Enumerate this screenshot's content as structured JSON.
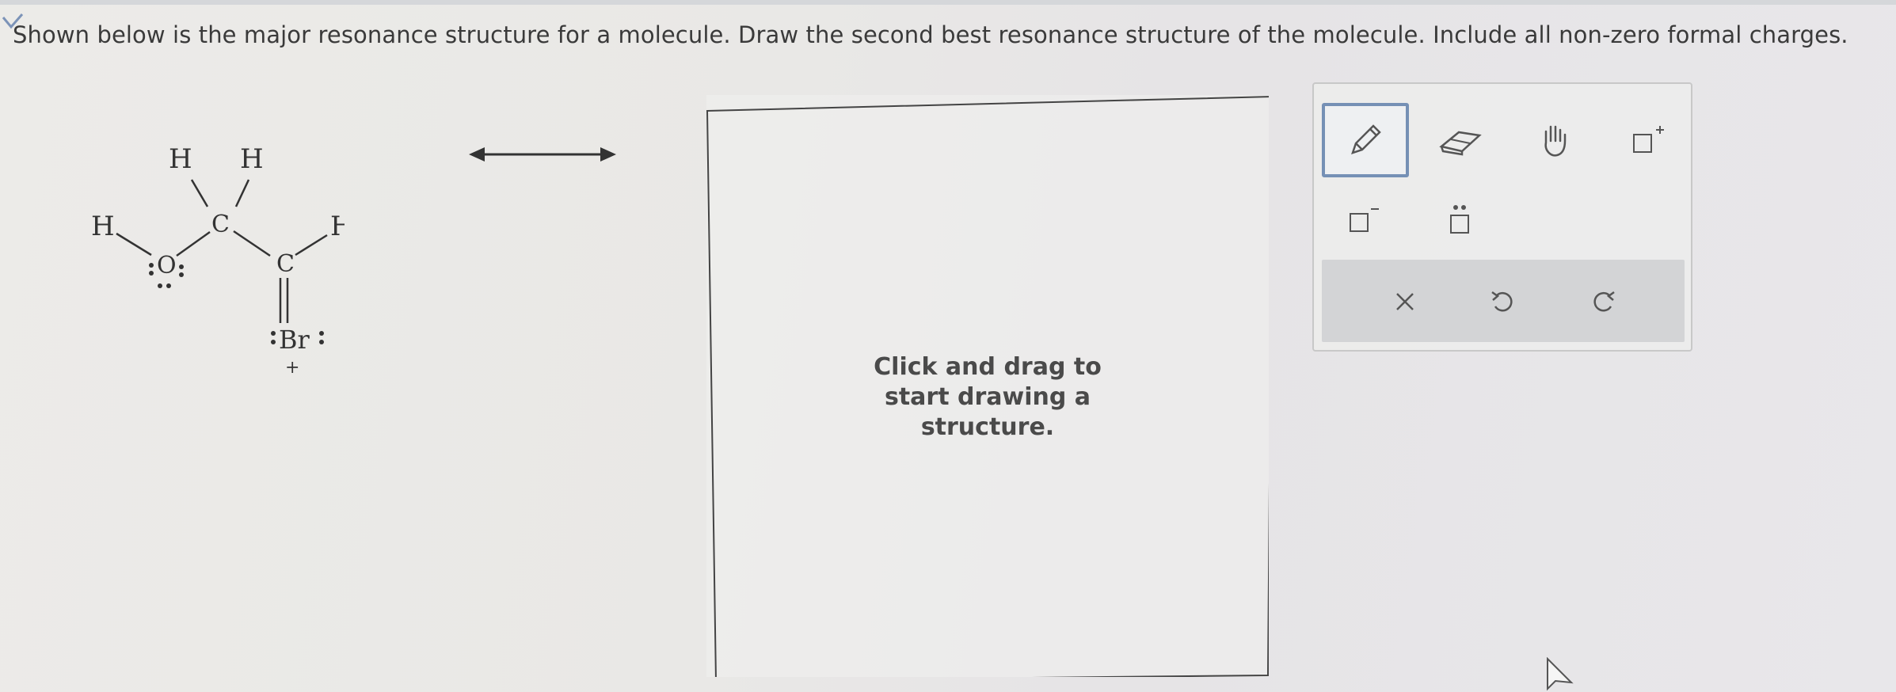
{
  "question": "Shown below is the major resonance structure for a molecule. Draw the second best resonance structure of the molecule. Include all non-zero formal charges.",
  "molecule": {
    "atoms": {
      "h_top_left": "H",
      "h_top_right": "H",
      "h_left": "H",
      "h_right": "H",
      "o": "O",
      "c1": "C",
      "c2": "C",
      "br": "Br",
      "br_charge": "+"
    }
  },
  "canvas": {
    "hint": "Click and drag to start drawing a structure."
  },
  "toolbar": {
    "tools": [
      {
        "name": "pencil-icon",
        "selected": true
      },
      {
        "name": "eraser-icon",
        "selected": false
      },
      {
        "name": "hand-icon",
        "selected": false
      },
      {
        "name": "positive-charge-icon",
        "selected": false
      },
      {
        "name": "negative-charge-icon",
        "selected": false
      },
      {
        "name": "lone-pair-icon",
        "selected": false
      }
    ],
    "actions": [
      "clear-icon",
      "undo-icon",
      "redo-icon"
    ]
  },
  "colors": {
    "selected_border": "#7590b5",
    "action_bar": "#d3d4d6"
  }
}
